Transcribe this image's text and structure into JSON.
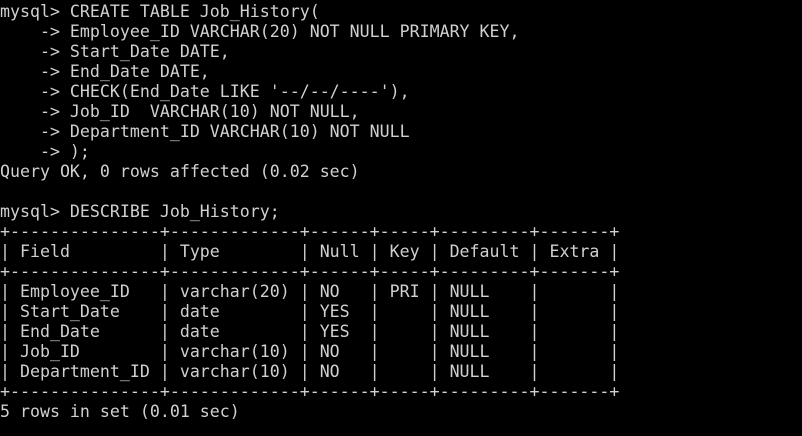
{
  "terminal": {
    "lines": [
      "mysql> CREATE TABLE Job_History(",
      "    -> Employee_ID VARCHAR(20) NOT NULL PRIMARY KEY,",
      "    -> Start_Date DATE,",
      "    -> End_Date DATE,",
      "    -> CHECK(End_Date LIKE '--/--/----'),",
      "    -> Job_ID  VARCHAR(10) NOT NULL,",
      "    -> Department_ID VARCHAR(10) NOT NULL",
      "    -> );",
      "Query OK, 0 rows affected (0.02 sec)",
      "",
      "mysql> DESCRIBE Job_History;",
      "+---------------+-------------+------+-----+---------+-------+",
      "| Field         | Type        | Null | Key | Default | Extra |",
      "+---------------+-------------+------+-----+---------+-------+",
      "| Employee_ID   | varchar(20) | NO   | PRI | NULL    |       |",
      "| Start_Date    | date        | YES  |     | NULL    |       |",
      "| End_Date      | date        | YES  |     | NULL    |       |",
      "| Job_ID        | varchar(10) | NO   |     | NULL    |       |",
      "| Department_ID | varchar(10) | NO   |     | NULL    |       |",
      "+---------------+-------------+------+-----+---------+-------+",
      "5 rows in set (0.01 sec)"
    ]
  }
}
